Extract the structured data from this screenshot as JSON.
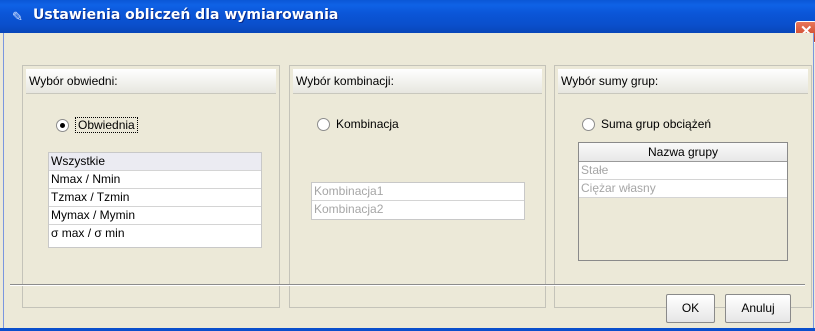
{
  "window": {
    "title": "Ustawienia obliczeń dla wymiarowania"
  },
  "panels": {
    "envelope": {
      "header": "Wybór obwiedni:",
      "radio_label": "Obwiednia",
      "list": [
        "Wszystkie",
        "Nmax / Nmin",
        "Tzmax / Tzmin",
        "Mymax / Mymin",
        "σ max / σ min"
      ]
    },
    "combination": {
      "header": "Wybór kombinacji:",
      "radio_label": "Kombinacja",
      "list": [
        "Kombinacja1",
        "Kombinacja2"
      ]
    },
    "groups": {
      "header": "Wybór sumy grup:",
      "radio_label": "Suma grup obciążeń",
      "table_header": "Nazwa grupy",
      "rows": [
        "Stałe",
        "Ciężar własny"
      ]
    }
  },
  "buttons": {
    "ok": "OK",
    "cancel": "Anuluj"
  },
  "colors": {
    "titlebar": "#0a4fcc",
    "dialog_bg": "#ece9d8",
    "close": "#d4502f"
  },
  "icons": {
    "title": "app-icon",
    "close": "close-icon"
  }
}
